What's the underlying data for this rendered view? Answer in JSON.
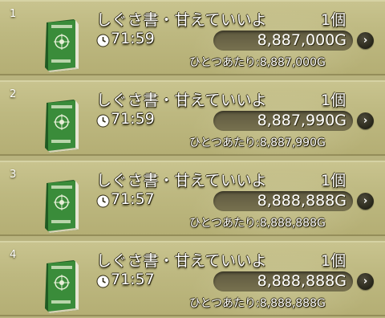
{
  "colors": {
    "background": "#b8b37e",
    "book_green": "#2f7a32",
    "price_box": "#6c6648",
    "text": "#ffffff"
  },
  "icons": {
    "item": "green-book-icon",
    "timer": "clock-icon",
    "detail": "chevron-right-icon"
  },
  "listings": [
    {
      "index": "1",
      "name": "しぐさ書・甘えていいよ",
      "quantity": "1個",
      "time": "71:59",
      "price": "8,887,000G",
      "unit_price": "ひとつあたり:8,887,000G"
    },
    {
      "index": "2",
      "name": "しぐさ書・甘えていいよ",
      "quantity": "1個",
      "time": "71:59",
      "price": "8,887,990G",
      "unit_price": "ひとつあたり:8,887,990G"
    },
    {
      "index": "3",
      "name": "しぐさ書・甘えていいよ",
      "quantity": "1個",
      "time": "71:57",
      "price": "8,888,888G",
      "unit_price": "ひとつあたり:8,888,888G"
    },
    {
      "index": "4",
      "name": "しぐさ書・甘えていいよ",
      "quantity": "1個",
      "time": "71:57",
      "price": "8,888,888G",
      "unit_price": "ひとつあたり:8,888,888G"
    }
  ]
}
